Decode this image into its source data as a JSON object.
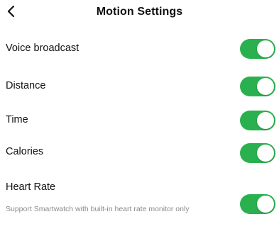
{
  "header": {
    "title": "Motion Settings",
    "back_icon": "chevron-left-icon"
  },
  "settings": [
    {
      "label": "Voice broadcast",
      "enabled": true
    },
    {
      "label": "Distance",
      "enabled": true
    },
    {
      "label": "Time",
      "enabled": true
    },
    {
      "label": "Calories",
      "enabled": true
    },
    {
      "label": "Heart Rate",
      "description": "Support Smartwatch with built-in heart rate monitor only",
      "enabled": true
    }
  ],
  "colors": {
    "toggle_on": "#2bb04f",
    "text_primary": "#111111",
    "text_secondary": "#8a8a8a",
    "background": "#ffffff"
  }
}
